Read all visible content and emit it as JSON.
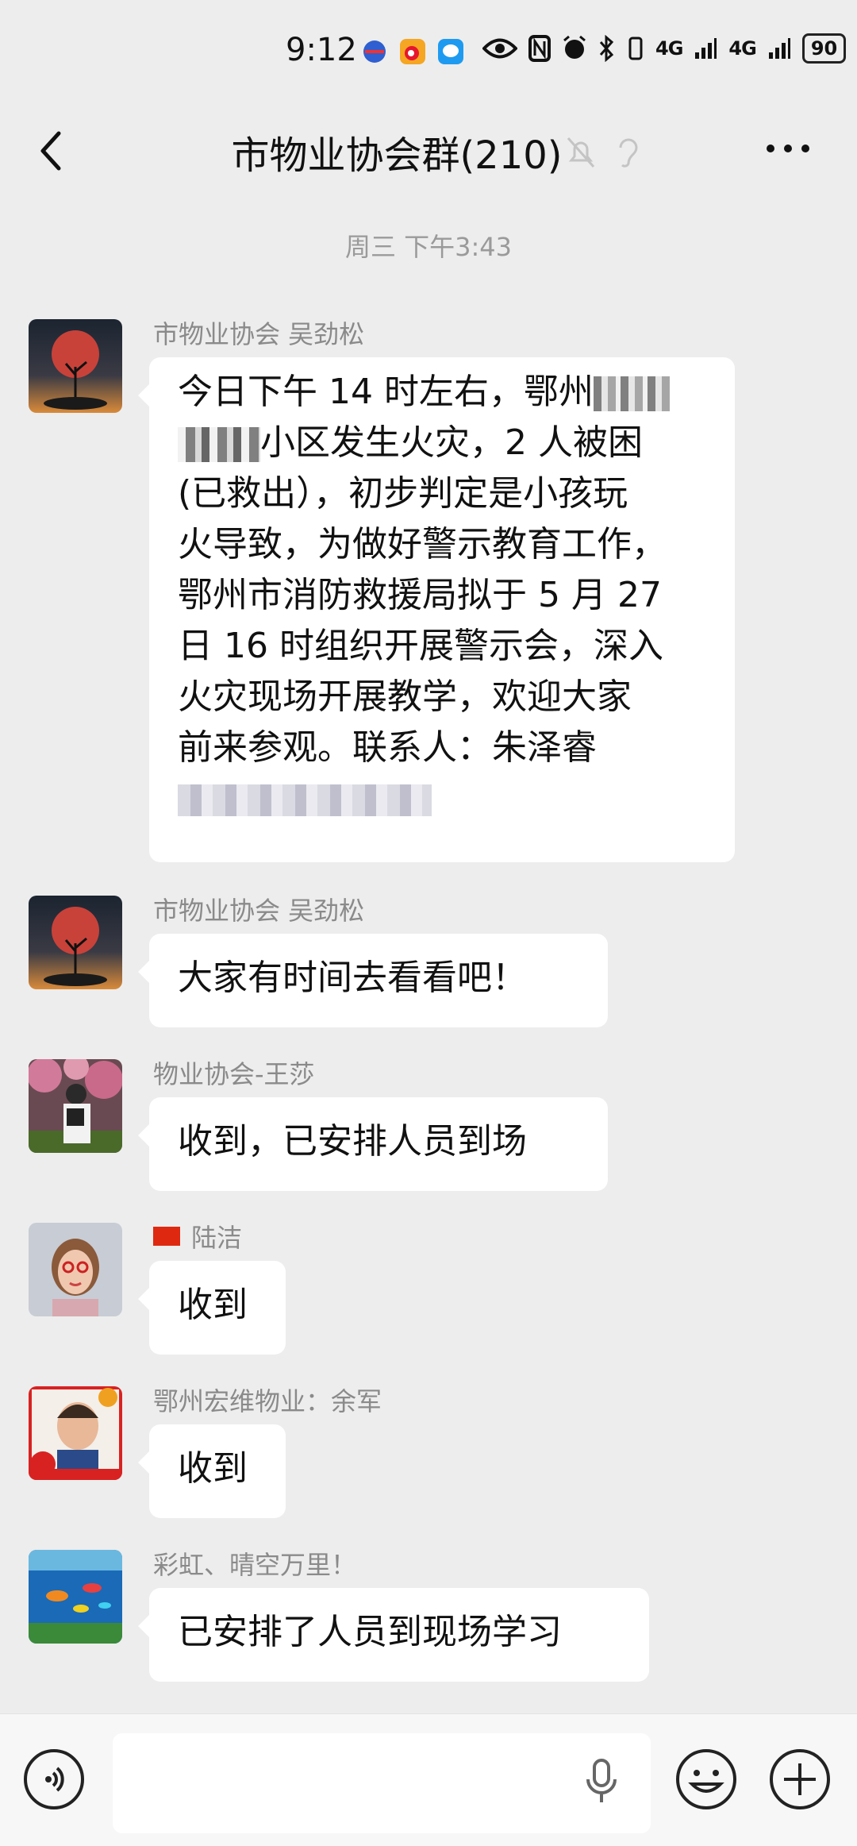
{
  "status_bar": {
    "time": "9:12",
    "signal_1": "4G",
    "signal_2": "4G",
    "battery": "90"
  },
  "header": {
    "title": "市物业协会群(210)"
  },
  "chat": {
    "time_separator": "周三 下午3:43",
    "messages": [
      {
        "sender": "市物业协会 吴劲松",
        "lines": [
          "今日下午 14 时左右，鄂州",
          "小区发生火灾，2 人被困",
          "(已救出），初步判定是小孩玩",
          "火导致，为做好警示教育工作，",
          "鄂州市消防救援局拟于 5 月 27",
          "日 16 时组织开展警示会，深入",
          "火灾现场开展教学，欢迎大家",
          "前来参观。联系人：朱泽睿"
        ]
      },
      {
        "sender": "市物业协会 吴劲松",
        "text": "大家有时间去看看吧！"
      },
      {
        "sender": "物业协会-王莎",
        "text": "收到，已安排人员到场"
      },
      {
        "sender": "陆洁",
        "text": "收到"
      },
      {
        "sender": "鄂州宏维物业：余军",
        "text": "收到"
      },
      {
        "sender": "彩虹、晴空万里！",
        "text": "已安排了人员到现场学习"
      }
    ]
  },
  "colors": {
    "background": "#ededed",
    "bubble": "#ffffff",
    "sender_text": "#8a8a8a",
    "timestamp": "#9a9a9a"
  }
}
